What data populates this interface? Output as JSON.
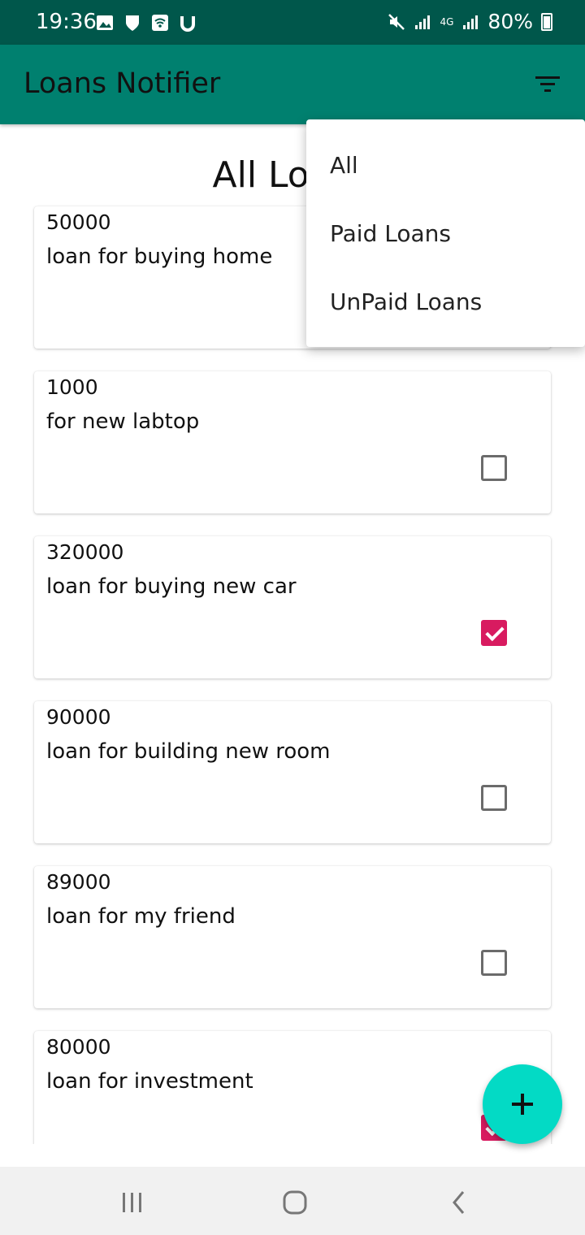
{
  "status_bar": {
    "time": "19:36",
    "battery": "80%",
    "network": "4G"
  },
  "app_bar": {
    "title": "Loans Notifier",
    "filter_icon": "filter-icon"
  },
  "page": {
    "title": "All Loans"
  },
  "loans": [
    {
      "amount": "50000",
      "description": "loan for buying home",
      "paid": false
    },
    {
      "amount": "1000",
      "description": "for new labtop",
      "paid": false
    },
    {
      "amount": "320000",
      "description": "loan for buying new car",
      "paid": true
    },
    {
      "amount": "90000",
      "description": "loan for building new room",
      "paid": false
    },
    {
      "amount": "89000",
      "description": "loan for my friend",
      "paid": false
    },
    {
      "amount": "80000",
      "description": "loan for investment",
      "paid": true
    }
  ],
  "menu": {
    "items": [
      {
        "label": "All"
      },
      {
        "label": "Paid Loans"
      },
      {
        "label": "UnPaid Loans"
      }
    ]
  },
  "fab": {
    "icon": "plus-icon"
  },
  "colors": {
    "status_bar": "#00574b",
    "app_bar": "#00806f",
    "accent": "#d81b60",
    "fab": "#03dac5"
  }
}
